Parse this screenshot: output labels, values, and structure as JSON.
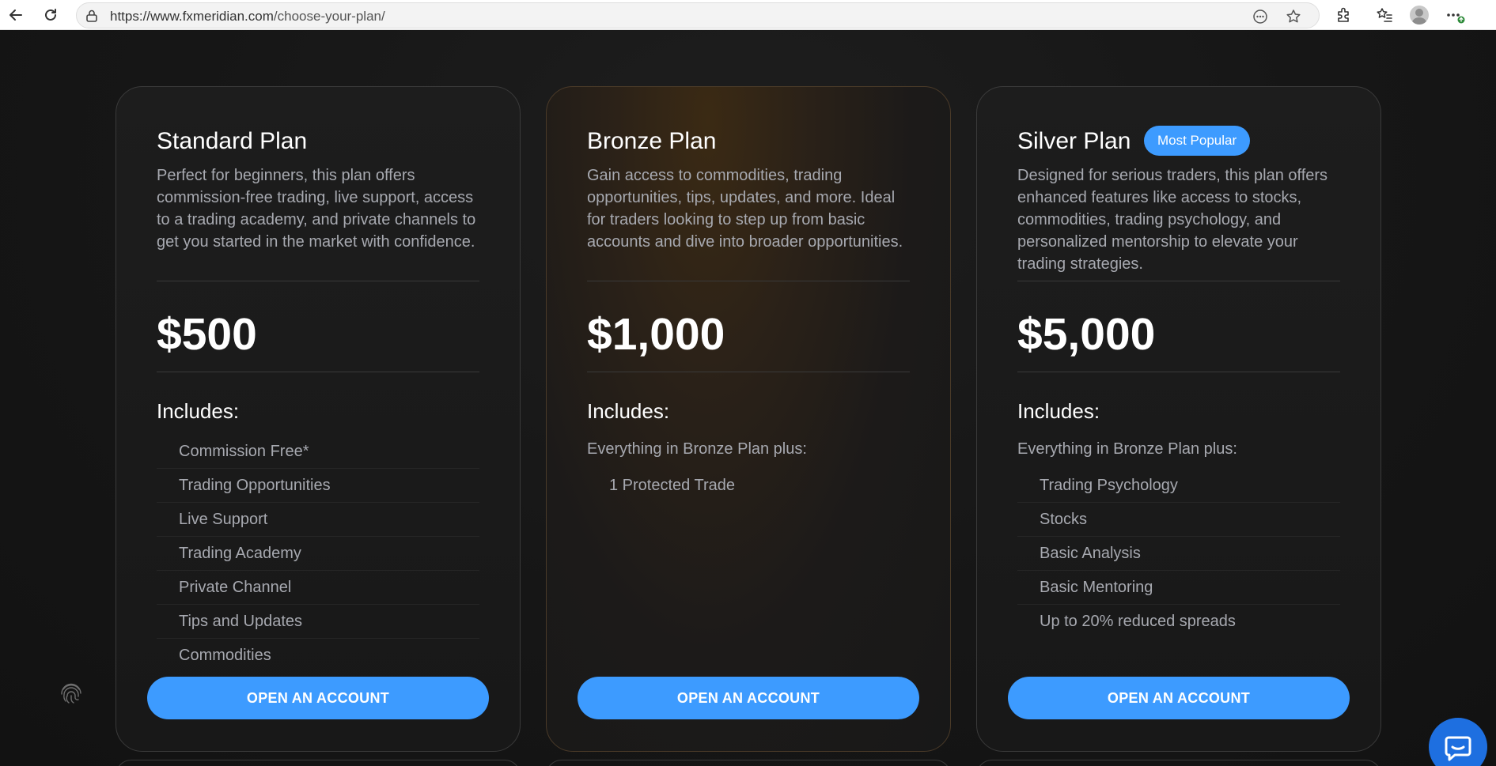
{
  "browser": {
    "url_domain": "https://www.fxmeridian.com",
    "url_path": "/choose-your-plan/",
    "icons": [
      "back-arrow-icon",
      "refresh-icon",
      "site-info-icon",
      "reader-icon",
      "favorite-star-icon",
      "extensions-icon",
      "favorites-list-icon",
      "profile-avatar-icon",
      "more-menu-icon"
    ]
  },
  "colors": {
    "accent": "#3d9bff",
    "page_background": "#141414",
    "muted_text": "#a7a9b0",
    "chat_button": "#1e6fe0"
  },
  "plans": [
    {
      "title": "Standard Plan",
      "description": "Perfect for beginners, this plan offers commission-free trading, live support, access to a trading academy, and private channels to get you started in the market with confidence.",
      "price": "$500",
      "includes_label": "Includes:",
      "intro": "",
      "features": [
        "Commission Free*",
        "Trading Opportunities",
        "Live Support",
        "Trading Academy",
        "Private Channel",
        "Tips and Updates",
        "Commodities"
      ],
      "cta": "OPEN AN ACCOUNT"
    },
    {
      "title": "Bronze Plan",
      "description": "Gain access to commodities, trading opportunities, tips, updates, and more. Ideal for traders looking to step up from basic accounts and dive into broader opportunities.",
      "price": "$1,000",
      "includes_label": "Includes:",
      "intro": "Everything in Bronze Plan plus:",
      "features": [
        "1 Protected Trade"
      ],
      "cta": "OPEN AN ACCOUNT"
    },
    {
      "title": "Silver Plan",
      "badge": "Most Popular",
      "description": "Designed for serious traders, this plan offers enhanced features like access to stocks, commodities, trading psychology, and personalized mentorship to elevate your trading strategies.",
      "price": "$5,000",
      "includes_label": "Includes:",
      "intro": "Everything in Bronze Plan plus:",
      "features": [
        "Trading Psychology",
        "Stocks",
        "Basic Analysis",
        "Basic Mentoring",
        "Up to 20% reduced spreads"
      ],
      "cta": "OPEN AN ACCOUNT"
    }
  ],
  "widgets": {
    "fingerprint_icon": "fingerprint-icon",
    "chat_icon": "chat-bubble-icon"
  }
}
